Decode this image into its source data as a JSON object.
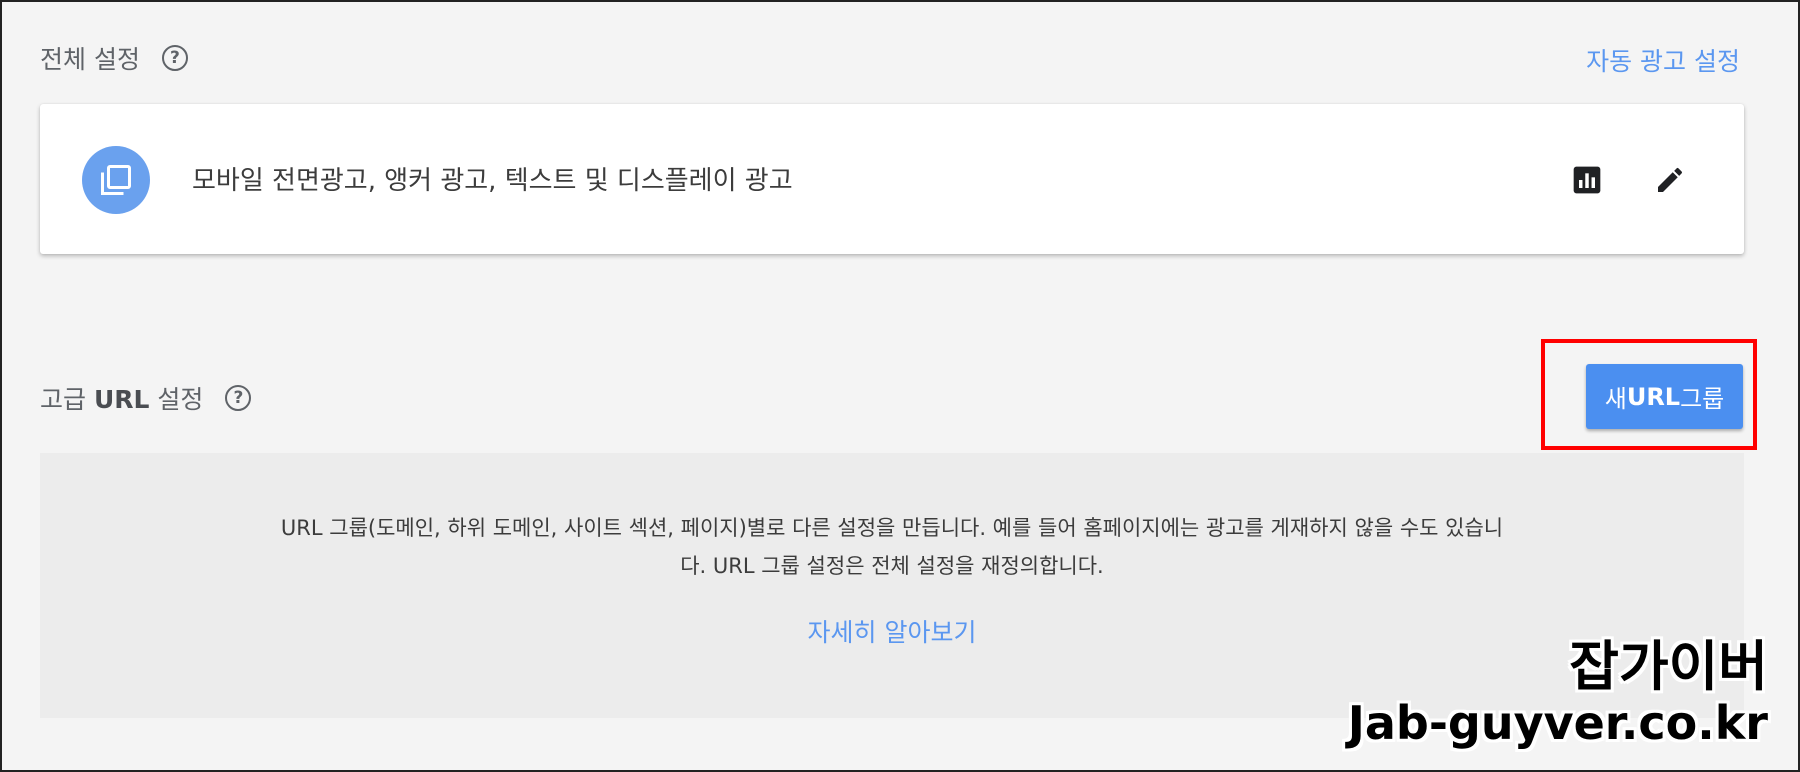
{
  "global_settings": {
    "title": "전체 설정",
    "auto_ads_link": "자동 광고 설정",
    "card_text": "모바일 전면광고, 앵커 광고, 텍스트 및 디스플레이 광고",
    "icons": [
      "ad-format-icon",
      "bar-chart-icon",
      "edit-pencil-icon"
    ]
  },
  "advanced_url": {
    "title_prefix": "고급 ",
    "title_bold": "URL",
    "title_suffix": " 설정",
    "new_group_prefix": "새 ",
    "new_group_bold": "URL",
    "new_group_suffix": " 그룹",
    "description_line1": "URL 그룹(도메인, 하위 도메인, 사이트 섹션, 페이지)별로 다른 설정을 만듭니다. 예를 들어 홈페이지에는 광고를 게재하지 않을 수도 있습니",
    "description_line2": "다. URL 그룹 설정은 전체 설정을 재정의합니다.",
    "learn_more": "자세히 알아보기"
  },
  "watermark": {
    "name": "잡가이버",
    "url": "Jab-guyver.co.kr"
  },
  "colors": {
    "accent": "#4b8ff0",
    "link": "#5b97f0",
    "highlight": "#ff0000"
  }
}
